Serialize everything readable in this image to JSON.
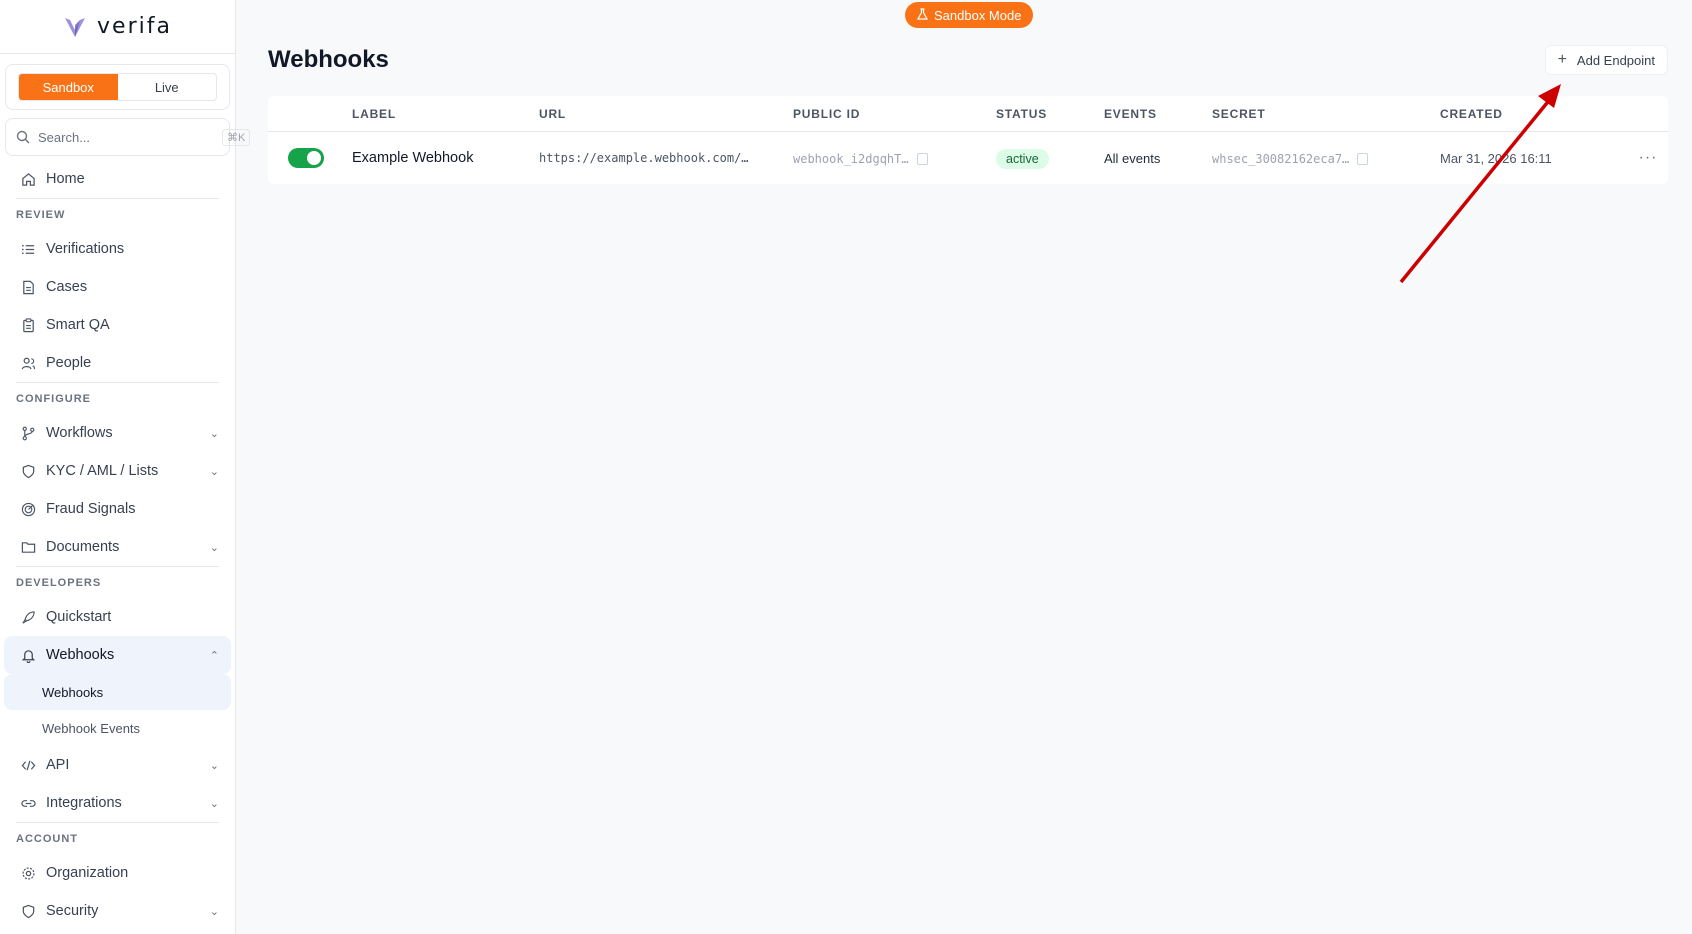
{
  "app": {
    "name": "verifa"
  },
  "env": {
    "sandbox_label": "Sandbox",
    "live_label": "Live",
    "active": "Sandbox"
  },
  "search": {
    "placeholder": "Search...",
    "shortcut": "⌘K"
  },
  "sidebar": {
    "home": "Home",
    "sections": {
      "review": "REVIEW",
      "configure": "CONFIGURE",
      "developers": "DEVELOPERS",
      "account": "ACCOUNT"
    },
    "review_items": [
      "Verifications",
      "Cases",
      "Smart QA",
      "People"
    ],
    "configure_items": [
      "Workflows",
      "KYC / AML / Lists",
      "Fraud Signals",
      "Documents"
    ],
    "developer_items": [
      "Quickstart",
      "Webhooks"
    ],
    "webhook_sub": [
      "Webhooks",
      "Webhook Events"
    ],
    "developer_items_after": [
      "API",
      "Integrations"
    ],
    "account_items": [
      "Organization",
      "Security"
    ]
  },
  "header": {
    "mode_badge": "Sandbox Mode",
    "title": "Webhooks",
    "add_button": "Add Endpoint"
  },
  "table": {
    "columns": [
      "LABEL",
      "URL",
      "PUBLIC ID",
      "STATUS",
      "EVENTS",
      "SECRET",
      "CREATED"
    ],
    "rows": [
      {
        "enabled": true,
        "label": "Example Webhook",
        "url": "https://example.webhook.com/…",
        "public_id": "webhook_i2dgqhT…",
        "status": "active",
        "events": "All events",
        "secret": "whsec_30082162eca7…",
        "created": "Mar 31, 2026 16:11"
      }
    ]
  },
  "colors": {
    "accent": "#f97316",
    "toggle_on": "#16a34a",
    "annotation_arrow": "#cc0000"
  }
}
